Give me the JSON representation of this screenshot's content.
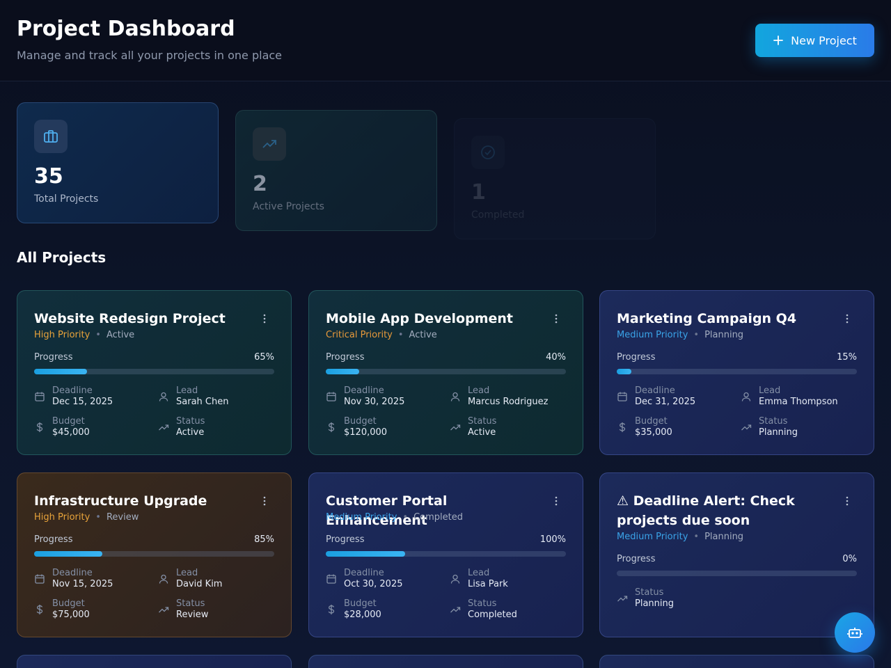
{
  "header": {
    "title": "Project Dashboard",
    "subtitle": "Manage and track all your projects in one place",
    "new_project_label": "New Project"
  },
  "stats": [
    {
      "value": "35",
      "label": "Total Projects",
      "icon": "briefcase-icon"
    },
    {
      "value": "2",
      "label": "Active Projects",
      "icon": "trending-up-icon"
    },
    {
      "value": "1",
      "label": "Completed",
      "icon": "check-circle-icon"
    }
  ],
  "section_title": "All Projects",
  "labels": {
    "progress": "Progress",
    "deadline": "Deadline",
    "lead": "Lead",
    "budget": "Budget",
    "status": "Status",
    "separator": "•"
  },
  "projects": [
    {
      "title": "Website Redesign Project",
      "priority": "High Priority",
      "state": "Active",
      "progress": 65,
      "progress_text": "65%",
      "deadline": "Dec 15, 2025",
      "lead": "Sarah Chen",
      "budget": "$45,000",
      "status": "Active"
    },
    {
      "title": "Mobile App Development",
      "priority": "Critical Priority",
      "state": "Active",
      "progress": 40,
      "progress_text": "40%",
      "deadline": "Nov 30, 2025",
      "lead": "Marcus Rodriguez",
      "budget": "$120,000",
      "status": "Active"
    },
    {
      "title": "Marketing Campaign Q4",
      "priority": "Medium Priority",
      "state": "Planning",
      "progress": 15,
      "progress_text": "15%",
      "deadline": "Dec 31, 2025",
      "lead": "Emma Thompson",
      "budget": "$35,000",
      "status": "Planning"
    },
    {
      "title": "Infrastructure Upgrade",
      "priority": "High Priority",
      "state": "Review",
      "progress": 85,
      "progress_text": "85%",
      "deadline": "Nov 15, 2025",
      "lead": "David Kim",
      "budget": "$75,000",
      "status": "Review"
    },
    {
      "title": "Customer Portal Enhancement",
      "priority": "Medium Priority",
      "state": "Completed",
      "progress": 100,
      "progress_text": "100%",
      "deadline": "Oct 30, 2025",
      "lead": "Lisa Park",
      "budget": "$28,000",
      "status": "Completed"
    },
    {
      "title": "⚠ Deadline Alert: Check projects due soon",
      "priority": "Medium Priority",
      "state": "Planning",
      "progress": 0,
      "progress_text": "0%",
      "status": "Planning"
    }
  ],
  "colors": {
    "accent": "#1b9fe0",
    "priority_high": "#e8a33a",
    "priority_medium": "#3aa3e8"
  },
  "fab_icon": "bot-icon"
}
